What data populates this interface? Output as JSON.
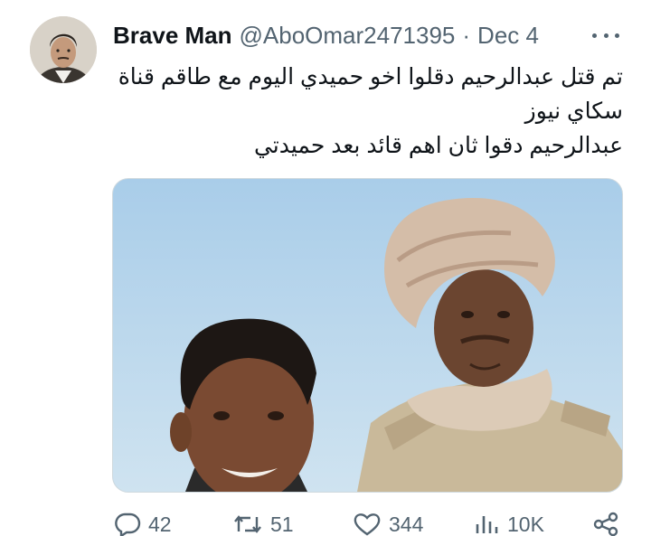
{
  "tweet": {
    "display_name": "Brave Man",
    "handle": "@AboOmar2471395",
    "separator": "·",
    "date": "Dec 4",
    "body_lines": [
      "تم قتل عبدالرحيم دقلوا اخو حميدي اليوم مع طاقم قناة",
      "سكاي نيوز",
      "عبدالرحيم دقوا ثان اهم قائد بعد حميدتي"
    ]
  },
  "actions": {
    "replies": "42",
    "retweets": "51",
    "likes": "344",
    "views": "10K"
  },
  "icons": {
    "more": "more-horizontal-icon",
    "reply": "reply-icon",
    "retweet": "retweet-icon",
    "like": "heart-icon",
    "views": "views-icon",
    "share": "share-icon"
  },
  "colors": {
    "text": "#0f1419",
    "secondary": "#536471",
    "border": "#cfd9de"
  }
}
